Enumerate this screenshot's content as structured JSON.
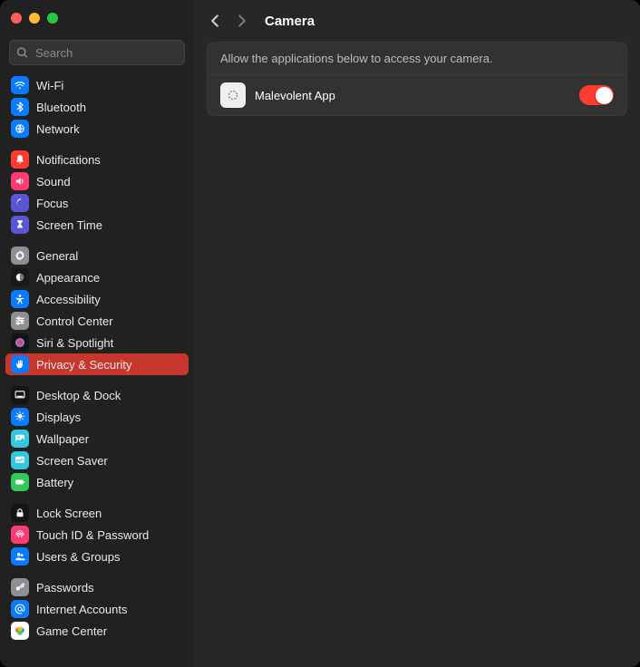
{
  "search": {
    "placeholder": "Search"
  },
  "header": {
    "title": "Camera"
  },
  "panel": {
    "description": "Allow the applications below to access your camera.",
    "app_name": "Malevolent App"
  },
  "sidebar": {
    "groups": [
      [
        {
          "id": "wifi",
          "label": "Wi-Fi",
          "bg": "#0a7aff",
          "icon": "wifi"
        },
        {
          "id": "bluetooth",
          "label": "Bluetooth",
          "bg": "#0a7aff",
          "icon": "bluetooth"
        },
        {
          "id": "network",
          "label": "Network",
          "bg": "#0a7aff",
          "icon": "network"
        }
      ],
      [
        {
          "id": "notifications",
          "label": "Notifications",
          "bg": "#ff3b30",
          "icon": "bell"
        },
        {
          "id": "sound",
          "label": "Sound",
          "bg": "#ff3b73",
          "icon": "sound"
        },
        {
          "id": "focus",
          "label": "Focus",
          "bg": "#5856d6",
          "icon": "moon"
        },
        {
          "id": "screen-time",
          "label": "Screen Time",
          "bg": "#5856d6",
          "icon": "hourglass"
        }
      ],
      [
        {
          "id": "general",
          "label": "General",
          "bg": "#8e8e93",
          "icon": "gear"
        },
        {
          "id": "appearance",
          "label": "Appearance",
          "bg": "#191919",
          "icon": "appearance"
        },
        {
          "id": "accessibility",
          "label": "Accessibility",
          "bg": "#0a7aff",
          "icon": "accessibility"
        },
        {
          "id": "control-center",
          "label": "Control Center",
          "bg": "#8e8e93",
          "icon": "sliders"
        },
        {
          "id": "siri",
          "label": "Siri & Spotlight",
          "bg": "#141414",
          "icon": "siri"
        },
        {
          "id": "privacy",
          "label": "Privacy & Security",
          "bg": "#0a7aff",
          "icon": "hand",
          "selected": true
        }
      ],
      [
        {
          "id": "desktop-dock",
          "label": "Desktop & Dock",
          "bg": "#141414",
          "icon": "dock"
        },
        {
          "id": "displays",
          "label": "Displays",
          "bg": "#0a7aff",
          "icon": "display"
        },
        {
          "id": "wallpaper",
          "label": "Wallpaper",
          "bg": "#33c7de",
          "icon": "wallpaper"
        },
        {
          "id": "screen-saver",
          "label": "Screen Saver",
          "bg": "#33c7de",
          "icon": "screensaver"
        },
        {
          "id": "battery",
          "label": "Battery",
          "bg": "#34c759",
          "icon": "battery"
        }
      ],
      [
        {
          "id": "lock-screen",
          "label": "Lock Screen",
          "bg": "#141414",
          "icon": "lock"
        },
        {
          "id": "touch-id",
          "label": "Touch ID & Password",
          "bg": "#ff3b73",
          "icon": "fingerprint"
        },
        {
          "id": "users-groups",
          "label": "Users & Groups",
          "bg": "#0a7aff",
          "icon": "users"
        }
      ],
      [
        {
          "id": "passwords",
          "label": "Passwords",
          "bg": "#8e8e93",
          "icon": "key"
        },
        {
          "id": "internet-accounts",
          "label": "Internet Accounts",
          "bg": "#0a7aff",
          "icon": "at"
        },
        {
          "id": "game-center",
          "label": "Game Center",
          "bg": "#ffffff",
          "icon": "gamecenter"
        }
      ]
    ]
  }
}
